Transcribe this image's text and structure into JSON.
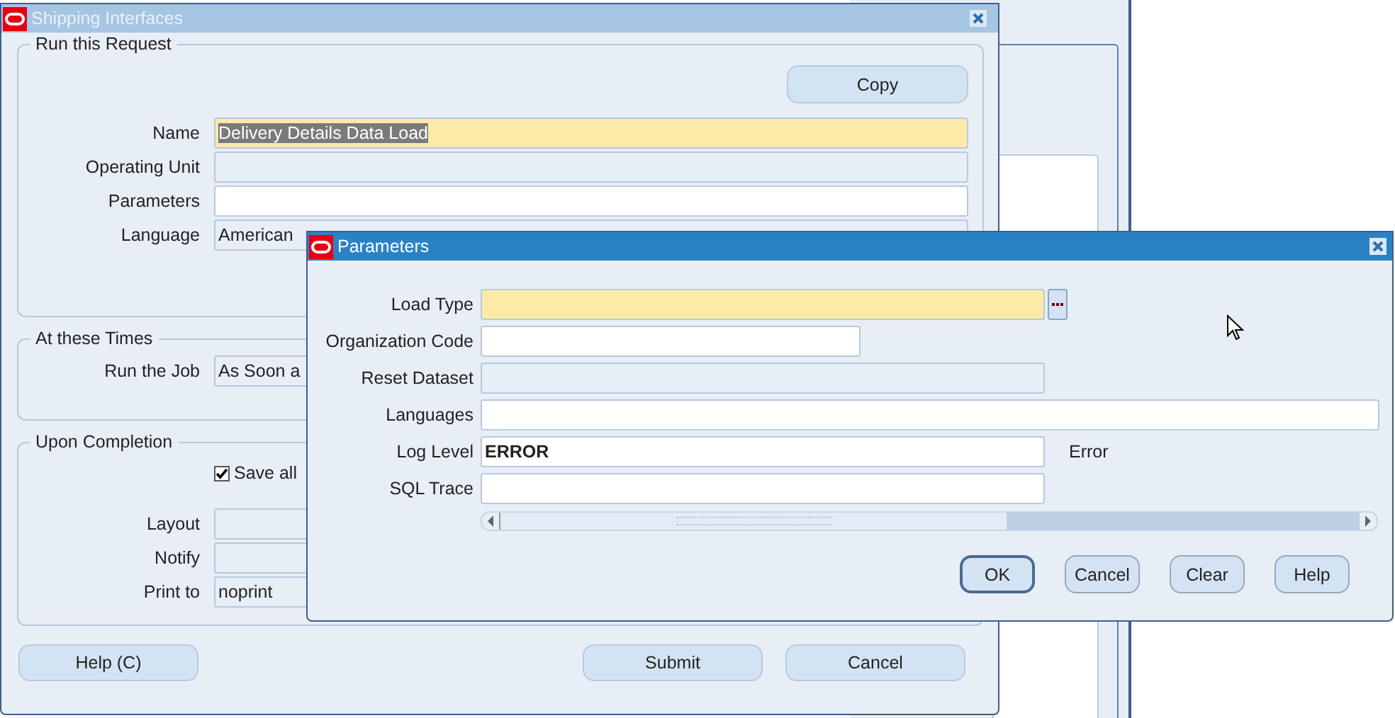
{
  "main_window": {
    "title": "Shipping Interfaces",
    "run_this_request": {
      "title": "Run this Request",
      "copy_button": {
        "label": "Copy"
      },
      "fields": [
        {
          "label": "Name",
          "kind": "required",
          "value": "Delivery Details Data Load",
          "selected": true
        },
        {
          "label": "Operating Unit",
          "kind": "disabled"
        },
        {
          "label": "Parameters",
          "kind": "text"
        },
        {
          "label": "Language",
          "kind": "disabled",
          "value": "American"
        }
      ]
    },
    "at_these_times": {
      "title": "At these Times",
      "fields": [
        {
          "label": "Run the Job",
          "kind": "disabled",
          "value": "As Soon a"
        }
      ]
    },
    "upon_completion": {
      "title": "Upon Completion",
      "checkbox": {
        "label": "Save all",
        "checked": true
      },
      "fields": [
        {
          "label": "Layout",
          "kind": "disabled"
        },
        {
          "label": "Notify",
          "kind": "disabled"
        },
        {
          "label": "Print to",
          "kind": "disabled",
          "value": "noprint"
        }
      ]
    },
    "buttons": [
      {
        "label": "Help (C)"
      },
      {
        "label": "Submit"
      },
      {
        "label": "Cancel"
      }
    ]
  },
  "parameters_dialog": {
    "title": "Parameters",
    "fields": [
      {
        "label": "Load Type",
        "kind": "required",
        "lov": true
      },
      {
        "label": "Organization Code",
        "kind": "text"
      },
      {
        "label": "Reset Dataset",
        "kind": "disabled"
      },
      {
        "label": "Languages",
        "kind": "text"
      },
      {
        "label": "Log Level",
        "kind": "text",
        "value": "ERROR",
        "description": "Error"
      },
      {
        "label": "SQL Trace",
        "kind": "text"
      }
    ],
    "buttons": [
      {
        "label": "OK",
        "default": true
      },
      {
        "label": "Cancel",
        "default": false
      },
      {
        "label": "Clear",
        "default": false
      },
      {
        "label": "Help",
        "default": false
      }
    ]
  }
}
